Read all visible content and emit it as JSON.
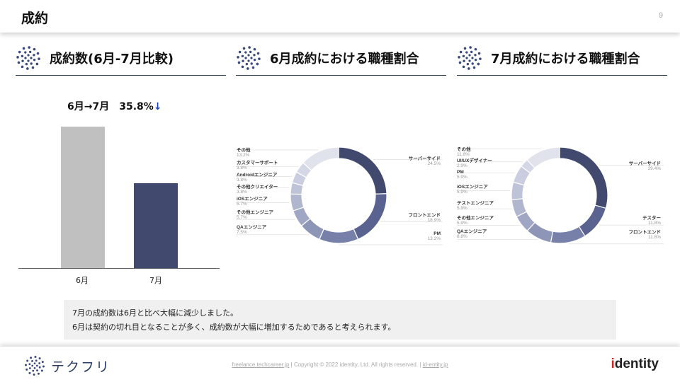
{
  "header": {
    "title": "成約",
    "page_number": "9"
  },
  "sections": [
    {
      "title": "成約数(6月-7月比較)"
    },
    {
      "title": "6月成約における職種割合"
    },
    {
      "title": "7月成約における職種割合"
    }
  ],
  "comparison": {
    "caption_prefix": "6月→7月",
    "change": "35.8%",
    "arrow": "↓"
  },
  "colors": {
    "gray": "#c0c0c0",
    "navy": "#414a6e",
    "arrow": "#1a3fb8"
  },
  "chart_data": [
    {
      "type": "bar",
      "categories": [
        "6月",
        "7月"
      ],
      "values": [
        1.0,
        0.6
      ],
      "colors": [
        "#c0c0c0",
        "#414a6e"
      ],
      "title": "",
      "xlabel": "",
      "ylabel": ""
    },
    {
      "type": "pie",
      "title": "",
      "slices": [
        {
          "name": "サーバーサイド",
          "pct": "24.5%",
          "value": 24.5,
          "color": "#414a6e"
        },
        {
          "name": "フロントエンド",
          "pct": "18.9%",
          "value": 18.9,
          "color": "#5a6390"
        },
        {
          "name": "PM",
          "pct": "13.2%",
          "value": 13.2,
          "color": "#7680a8"
        },
        {
          "name": "QAエンジニア",
          "pct": "7.5%",
          "value": 7.5,
          "color": "#8e96b8"
        },
        {
          "name": "その他エンジニア",
          "pct": "5.7%",
          "value": 5.7,
          "color": "#a0a7c4"
        },
        {
          "name": "iOSエンジニア",
          "pct": "5.7%",
          "value": 5.7,
          "color": "#b0b6ce"
        },
        {
          "name": "その他クリエイター",
          "pct": "3.8%",
          "value": 3.8,
          "color": "#bec3d7"
        },
        {
          "name": "Androidエンジニア",
          "pct": "3.8%",
          "value": 3.8,
          "color": "#c9cddf"
        },
        {
          "name": "カスタマーサポート",
          "pct": "3.8%",
          "value": 3.8,
          "color": "#d4d7e6"
        },
        {
          "name": "その他",
          "pct": "13.2%",
          "value": 13.2,
          "color": "#e0e2ec"
        }
      ]
    },
    {
      "type": "pie",
      "title": "",
      "slices": [
        {
          "name": "サーバーサイド",
          "pct": "29.4%",
          "value": 29.4,
          "color": "#414a6e"
        },
        {
          "name": "テスター",
          "pct": "11.8%",
          "value": 11.8,
          "color": "#5a6390"
        },
        {
          "name": "フロントエンド",
          "pct": "11.8%",
          "value": 11.8,
          "color": "#7680a8"
        },
        {
          "name": "QAエンジニア",
          "pct": "8.8%",
          "value": 8.8,
          "color": "#8e96b8"
        },
        {
          "name": "その他エンジニア",
          "pct": "5.9%",
          "value": 5.9,
          "color": "#a0a7c4"
        },
        {
          "name": "テストエンジニア",
          "pct": "5.9%",
          "value": 5.9,
          "color": "#b0b6ce"
        },
        {
          "name": "iOSエンジニア",
          "pct": "5.9%",
          "value": 5.9,
          "color": "#bec3d7"
        },
        {
          "name": "PM",
          "pct": "5.9%",
          "value": 5.9,
          "color": "#c9cddf"
        },
        {
          "name": "UI/UXデザイナー",
          "pct": "2.9%",
          "value": 2.9,
          "color": "#d4d7e6"
        },
        {
          "name": "その他",
          "pct": "11.8%",
          "value": 11.8,
          "color": "#e0e2ec"
        }
      ]
    }
  ],
  "note": {
    "line1": "7月の成約数は6月と比べ大幅に減少しました。",
    "line2": "6月は契約の切れ目となることが多く、成約数が大幅に増加するためであると考えられます。"
  },
  "footer": {
    "brand": "テクフリ",
    "link1": "freelance.techcareer.jp",
    "sep1": " | ",
    "copyright": "Copyright © 2022 identity, Ltd. All rights reserved.",
    "sep2": " | ",
    "link2": "id-entity.jp",
    "logo_i": "i",
    "logo_rest": "dentity"
  }
}
